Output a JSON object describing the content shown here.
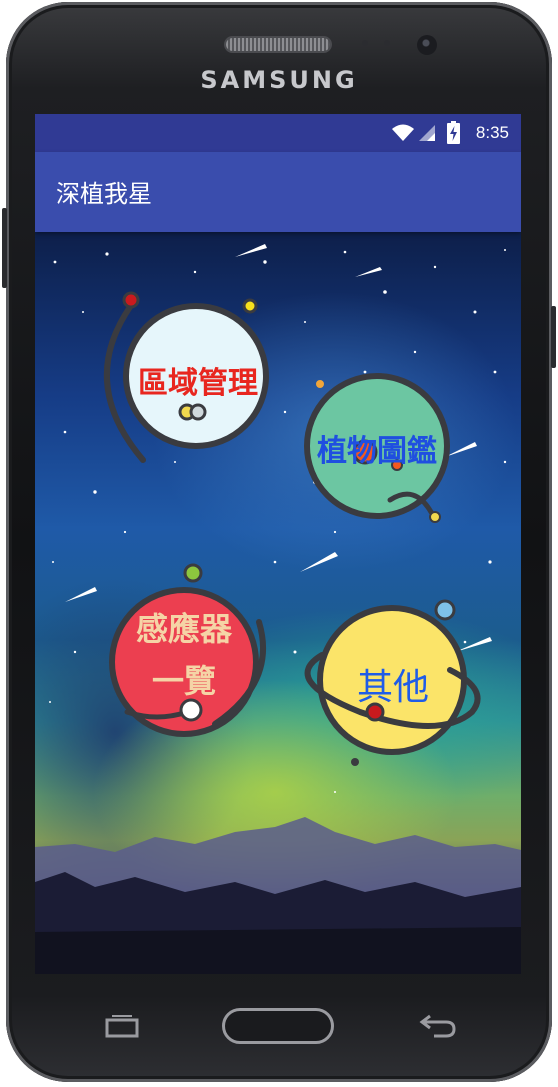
{
  "device": {
    "brand": "SAMSUNG",
    "frame_color": "#1a1b1e"
  },
  "status_bar": {
    "time": "8:35",
    "icons": [
      "wifi-icon",
      "cellular-signal-icon",
      "battery-charging-icon"
    ],
    "color": "#303a94"
  },
  "app_bar": {
    "title": "深植我星",
    "color": "#3a4dad"
  },
  "menu": {
    "area_management": {
      "label": "區域管理",
      "planet_color": "#e6f6fb",
      "text_color": "#e8261f"
    },
    "plant_guide": {
      "label": "植物圖鑑",
      "planet_color": "#6cc6a2",
      "text_color": "#1f4fe0"
    },
    "sensor_list": {
      "label_line1": "感應器",
      "label_line2": "一覽",
      "planet_color": "#ec3f50",
      "text_color": "#f5d4a6"
    },
    "others": {
      "label": "其他",
      "planet_color": "#fbe469",
      "text_color": "#1f5ce8"
    }
  },
  "nav_bar": {
    "icons": [
      "recent-apps-icon",
      "home-button",
      "back-icon"
    ]
  }
}
